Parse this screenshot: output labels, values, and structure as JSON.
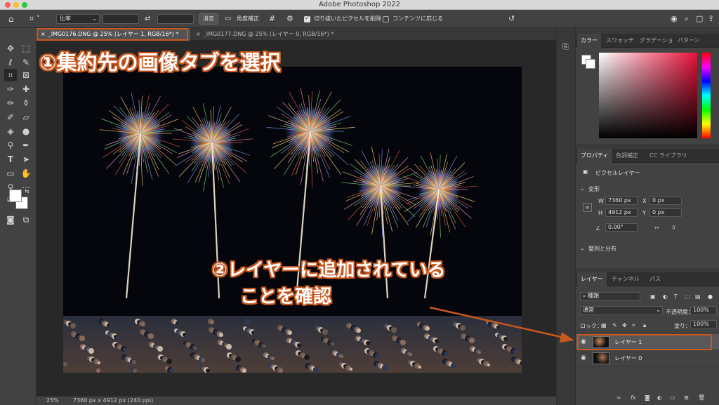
{
  "window": {
    "title": "Adobe Photoshop 2022"
  },
  "options_bar": {
    "ratio_label": "比率",
    "clear_label": "消去",
    "straighten_label": "角度補正",
    "delete_cropped_label": "切り抜いたピクセルを削除",
    "content_aware_label": "コンテンツに応じる"
  },
  "doc_tabs": [
    {
      "label": "_IMG0176.DNG @ 25% (レイヤー 1, RGB/16*) *",
      "active": true
    },
    {
      "label": "_IMG0177.DNG @ 25% (レイヤー 0, RGB/16*) *",
      "active": false
    }
  ],
  "status": {
    "zoom": "25%",
    "info": "7360 px x 4912 px (240 ppi)"
  },
  "color_panel": {
    "tabs": [
      "カラー",
      "スウォッチ",
      "グラデーショ",
      "パターン"
    ]
  },
  "properties_panel": {
    "tabs": [
      "プロパティ",
      "色調補正",
      "CC ライブラリ"
    ],
    "kind_label": "ピクセルレイヤー",
    "transform_label": "変形",
    "w_label": "W",
    "w_value": "7360 px",
    "x_label": "X",
    "x_value": "0 px",
    "h_label": "H",
    "h_value": "4912 px",
    "y_label": "Y",
    "y_value": "0 px",
    "angle_value": "0.00°",
    "align_label": "整列と分布"
  },
  "layers_panel": {
    "tabs": [
      "レイヤー",
      "チャンネル",
      "パス"
    ],
    "filter_label": "種類",
    "blend_mode": "通常",
    "opacity_label": "不透明度：",
    "opacity_value": "100%",
    "lock_label": "ロック：",
    "fill_label": "塗り：",
    "fill_value": "100%",
    "layers": [
      {
        "name": "レイヤー 1",
        "selected": true
      },
      {
        "name": "レイヤー 0",
        "selected": false
      }
    ]
  },
  "annotations": {
    "step1": "①集約先の画像タブを選択",
    "step2_line1": "②レイヤーに追加されている",
    "step2_line2": "ことを確認"
  },
  "colors": {
    "annotation": "#c9581f",
    "accent": "#2b6fd6"
  }
}
